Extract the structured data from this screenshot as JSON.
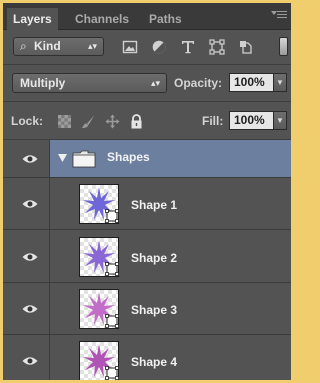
{
  "tabs": [
    {
      "label": "Layers",
      "active": true
    },
    {
      "label": "Channels",
      "active": false
    },
    {
      "label": "Paths",
      "active": false
    }
  ],
  "filter": {
    "kind_label": "Kind",
    "kind_icon": "search-icon",
    "filter_icons": [
      "pixel-layer-filter-icon",
      "adjustment-filter-icon",
      "type-filter-icon",
      "shape-filter-icon",
      "smart-object-filter-icon"
    ]
  },
  "blend": {
    "mode": "Multiply",
    "opacity_label": "Opacity:",
    "opacity_value": "100%"
  },
  "lock": {
    "label": "Lock:",
    "fill_label": "Fill:",
    "fill_value": "100%",
    "lock_icons": [
      "lock-transparent-pixels-icon",
      "lock-image-pixels-icon",
      "lock-position-icon",
      "lock-all-icon"
    ]
  },
  "group": {
    "name": "Shapes",
    "expanded": true,
    "selected": true,
    "highlight_color": "#6c7f9f"
  },
  "layers": [
    {
      "name": "Shape 1",
      "color": "#6f66d8"
    },
    {
      "name": "Shape 2",
      "color": "#8b67d6"
    },
    {
      "name": "Shape 3",
      "color": "#c26ec8"
    },
    {
      "name": "Shape 4",
      "color": "#b054b5"
    }
  ],
  "colors": {
    "panel_bg": "#535353",
    "frame_bg": "#f0ce6d",
    "tab_bar_bg": "#3a3a3a"
  }
}
